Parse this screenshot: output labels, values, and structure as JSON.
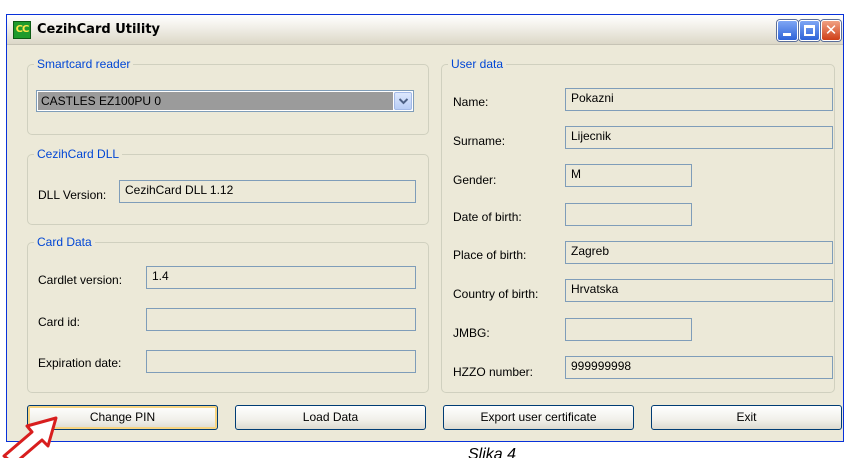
{
  "window": {
    "title": "CezihCard Utility",
    "icon_text": "CC"
  },
  "smartcard_reader": {
    "legend": "Smartcard reader",
    "selected": "CASTLES EZ100PU 0"
  },
  "dll": {
    "legend": "CezihCard DLL",
    "version_label": "DLL Version:",
    "version_value": "CezihCard DLL 1.12"
  },
  "card_data": {
    "legend": "Card Data",
    "cardlet_label": "Cardlet version:",
    "cardlet_value": "1.4",
    "card_id_label": "Card id:",
    "card_id_value": "",
    "expiration_label": "Expiration date:",
    "expiration_value": ""
  },
  "user_data": {
    "legend": "User data",
    "fields": [
      {
        "label": "Name:",
        "value": "Pokazni"
      },
      {
        "label": "Surname:",
        "value": "Lijecnik"
      },
      {
        "label": "Gender:",
        "value": "M"
      },
      {
        "label": "Date of birth:",
        "value": ""
      },
      {
        "label": "Place of birth:",
        "value": "Zagreb"
      },
      {
        "label": "Country of birth:",
        "value": "Hrvatska"
      },
      {
        "label": "JMBG:",
        "value": ""
      },
      {
        "label": "HZZO number:",
        "value": "999999998"
      }
    ]
  },
  "buttons": {
    "change_pin": "Change PIN",
    "load_data": "Load Data",
    "export_cert": "Export user certificate",
    "exit": "Exit"
  },
  "caption": "Slika 4",
  "colors": {
    "legend": "#0046d5",
    "window_bg": "#ece9d8",
    "annotation_arrow": "#d81e1e"
  }
}
